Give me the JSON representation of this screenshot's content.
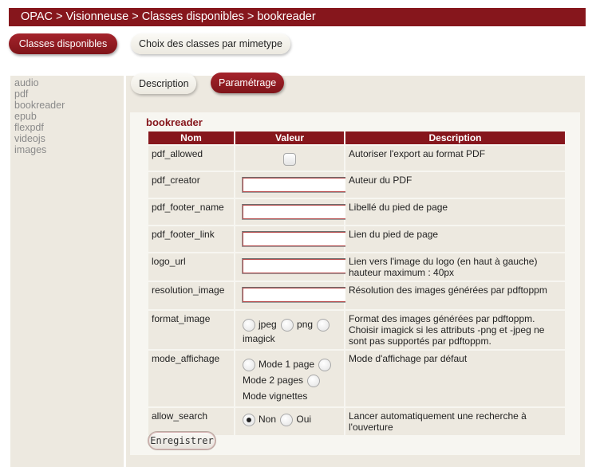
{
  "breadcrumb": [
    "OPAC",
    "Visionneuse",
    "Classes disponibles",
    "bookreader"
  ],
  "breadcrumb_separator": ">",
  "top_tabs": {
    "classes": "Classes disponibles",
    "mimetype": "Choix des classes par mimetype"
  },
  "sub_tabs": {
    "description": "Description",
    "parametrage": "Paramétrage"
  },
  "sidebar": [
    "audio",
    "pdf",
    "bookreader",
    "epub",
    "flexpdf",
    "videojs",
    "images"
  ],
  "section_title": "bookreader",
  "table": {
    "headers": [
      "Nom",
      "Valeur",
      "Description"
    ],
    "rows": [
      {
        "name": "pdf_allowed",
        "description": "Autoriser l'export au format PDF"
      },
      {
        "name": "pdf_creator",
        "description": "Auteur du PDF"
      },
      {
        "name": "pdf_footer_name",
        "description": "Libellé du pied de page"
      },
      {
        "name": "pdf_footer_link",
        "description": "Lien du pied de page"
      },
      {
        "name": "logo_url",
        "description": "Lien vers l'image du logo (en haut à gauche) hauteur maximum : 40px"
      },
      {
        "name": "resolution_image",
        "description": "Résolution des images générées par pdftoppm"
      },
      {
        "name": "format_image",
        "description": "Format des images générées par pdftoppm. Choisir imagick si les attributs -png et -jpeg ne sont pas supportés par pdftoppm.",
        "options": [
          "jpeg",
          "png",
          "imagick"
        ]
      },
      {
        "name": "mode_affichage",
        "description": "Mode d'affichage par défaut",
        "options": [
          "Mode 1 page",
          "Mode 2 pages",
          "Mode vignettes"
        ]
      },
      {
        "name": "allow_search",
        "description": "Lancer automatiquement une recherche à l'ouverture",
        "options": [
          "Non",
          "Oui"
        ],
        "selected": "Non"
      }
    ]
  },
  "save_label": "Enregistrer",
  "colors": {
    "accent": "#86161c",
    "panel": "#ede9e0"
  }
}
